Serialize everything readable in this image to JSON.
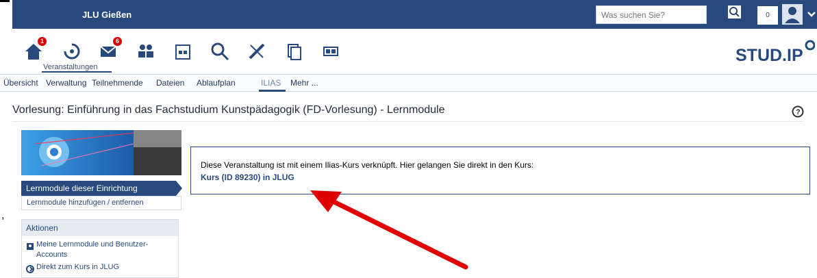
{
  "edge_text": ",",
  "top": {
    "site_title": "JLU Gießen",
    "search_placeholder": "Was suchen Sie?",
    "notification_count": "0"
  },
  "nav": {
    "home_badge": "1",
    "mail_badge": "6",
    "active_label": "Veranstaltungen"
  },
  "tabs": [
    "Übersicht",
    "Verwaltung",
    "Teilnehmende",
    "Dateien",
    "Ablaufplan",
    "ILIAS",
    "Mehr ..."
  ],
  "page_title": "Vorlesung: Einführung in das Fachstudium Kunstpädagogik (FD-Vorlesung) - Lernmodule",
  "sidebar": {
    "active": "Lernmodule dieser Einrichtung",
    "item": "Lernmodule hinzufügen / entfernen",
    "actions_title": "Aktionen",
    "action1_line1": "Meine Lernmodule und Benutzer-",
    "action1_line2": "Accounts",
    "action2": "Direkt zum Kurs in JLUG"
  },
  "info": {
    "text": "Diese Veranstaltung ist mit einem Ilias-Kurs verknüpft. Hier gelangen Sie direkt in den Kurs:",
    "link": "Kurs (ID 89230) in JLUG"
  },
  "logo": "STUD.IP",
  "colors": {
    "primary": "#28497c",
    "badge": "#d60000",
    "arrow": "#e10000"
  }
}
